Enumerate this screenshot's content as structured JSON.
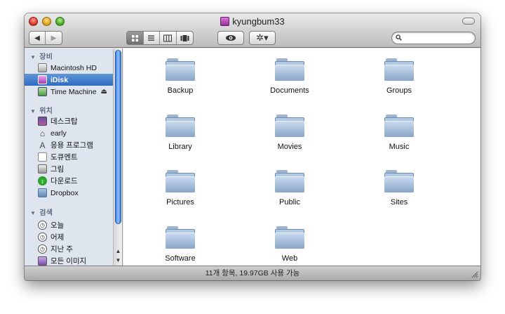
{
  "window": {
    "title": "kyungbum33"
  },
  "toolbar": {
    "back_glyph": "◀",
    "forward_glyph": "▶",
    "view_modes": [
      "icon-view-icon",
      "list-view-icon",
      "column-view-icon",
      "coverflow-view-icon"
    ],
    "active_view": 0,
    "quicklook_icon": "eye-icon",
    "action_glyph": "✲▾",
    "search_value": "",
    "search_placeholder": ""
  },
  "sidebar": {
    "sections": [
      {
        "title": "장비",
        "items": [
          {
            "label": "Macintosh HD",
            "icon": "hard-drive-icon",
            "selected": false
          },
          {
            "label": "iDisk",
            "icon": "idisk-icon",
            "selected": true
          },
          {
            "label": "Time Machine",
            "icon": "time-machine-icon",
            "selected": false,
            "eject": "⏏"
          }
        ]
      },
      {
        "title": "위치",
        "items": [
          {
            "label": "데스크탑",
            "icon": "desktop-icon"
          },
          {
            "label": "early",
            "icon": "home-icon"
          },
          {
            "label": "응용 프로그램",
            "icon": "applications-icon"
          },
          {
            "label": "도큐멘트",
            "icon": "documents-icon"
          },
          {
            "label": "그림",
            "icon": "pictures-icon"
          },
          {
            "label": "다운로드",
            "icon": "downloads-icon"
          },
          {
            "label": "Dropbox",
            "icon": "dropbox-folder-icon"
          }
        ]
      },
      {
        "title": "검색",
        "items": [
          {
            "label": "오늘",
            "icon": "clock-icon"
          },
          {
            "label": "어제",
            "icon": "clock-icon"
          },
          {
            "label": "지난 주",
            "icon": "clock-icon"
          },
          {
            "label": "모든 이미지",
            "icon": "all-images-icon"
          }
        ]
      }
    ]
  },
  "content": {
    "items": [
      {
        "label": "Backup"
      },
      {
        "label": "Documents"
      },
      {
        "label": "Groups"
      },
      {
        "label": "Library"
      },
      {
        "label": "Movies"
      },
      {
        "label": "Music"
      },
      {
        "label": "Pictures"
      },
      {
        "label": "Public"
      },
      {
        "label": "Sites"
      },
      {
        "label": "Software"
      },
      {
        "label": "Web"
      }
    ]
  },
  "status": {
    "text": "11개 항목, 19.97GB 사용 가능"
  },
  "colors": {
    "selection": "#2f6cc2",
    "sidebar_bg": "#dfe5ee",
    "folder": "#88a6c8"
  }
}
